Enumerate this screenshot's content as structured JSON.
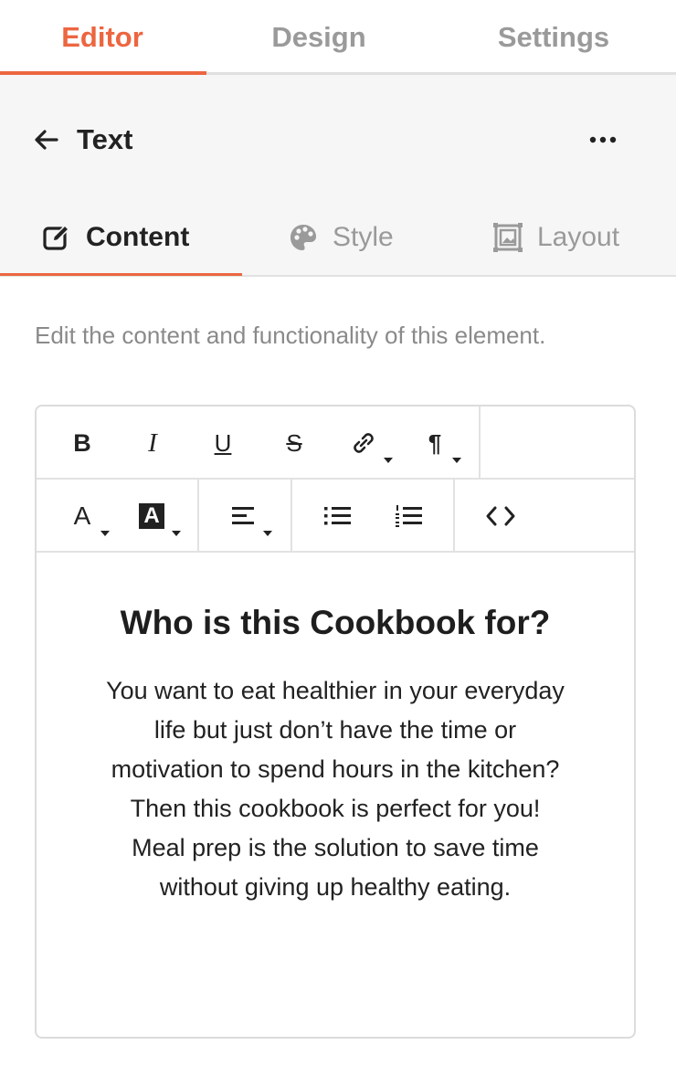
{
  "top_tabs": [
    {
      "label": "Editor",
      "active": true
    },
    {
      "label": "Design",
      "active": false
    },
    {
      "label": "Settings",
      "active": false
    }
  ],
  "header": {
    "title": "Text",
    "back_icon": "arrow-left-icon",
    "more_icon": "more-horizontal-icon"
  },
  "sub_tabs": [
    {
      "label": "Content",
      "icon": "edit-icon",
      "active": true
    },
    {
      "label": "Style",
      "icon": "palette-icon",
      "active": false
    },
    {
      "label": "Layout",
      "icon": "layout-icon",
      "active": false
    }
  ],
  "description": "Edit the content and functionality of this element.",
  "toolbar": {
    "row1": [
      {
        "name": "bold",
        "glyph": "B"
      },
      {
        "name": "italic",
        "glyph": "I"
      },
      {
        "name": "underline",
        "glyph": "U"
      },
      {
        "name": "strikethrough",
        "glyph": "S"
      },
      {
        "name": "link",
        "glyph": "link"
      },
      {
        "name": "paragraph",
        "glyph": "¶"
      }
    ],
    "row2": [
      {
        "name": "text-color",
        "glyph": "A"
      },
      {
        "name": "background-color",
        "glyph": "A"
      },
      {
        "name": "align",
        "glyph": "align"
      },
      {
        "name": "bullet-list",
        "glyph": "ul"
      },
      {
        "name": "numbered-list",
        "glyph": "ol"
      },
      {
        "name": "code-view",
        "glyph": "<>"
      }
    ]
  },
  "content": {
    "heading": "Who is this Cookbook for?",
    "paragraph_lines": [
      "You want to eat healthier in your everyday",
      "life but just don’t have the time or",
      "motivation to spend hours in the kitchen?",
      "Then this cookbook is perfect for you!",
      "Meal prep is the solution to save time",
      "without giving up healthy eating."
    ]
  },
  "colors": {
    "accent": "#ec6640",
    "muted_text": "#9a9a9a",
    "header_bg": "#f6f6f6"
  }
}
